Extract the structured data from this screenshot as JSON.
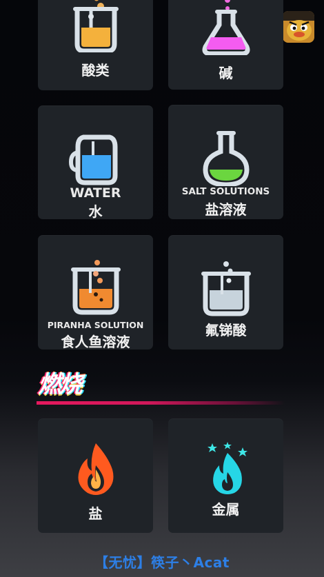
{
  "categories_top": [
    {
      "cn": "酸类",
      "en": ""
    },
    {
      "cn": "碱",
      "en": ""
    },
    {
      "cn": "水",
      "en": "WATER"
    },
    {
      "cn": "盐溶液",
      "en": "SALT SOLUTIONS"
    },
    {
      "cn": "食人鱼溶液",
      "en": "PIRANHA SOLUTION"
    },
    {
      "cn": "氟锑酸",
      "en": ""
    }
  ],
  "combustion_section": {
    "title": "燃烧",
    "items": [
      {
        "cn": "盐"
      },
      {
        "cn": "金属"
      }
    ]
  },
  "footer": {
    "credit": "【无忧】筷子丶Acat"
  },
  "icons": {
    "acids": "beaker-yellow-liquid-icon",
    "bases": "flask-pink-liquid-icon",
    "water": "water-jug-icon",
    "salt_solutions": "round-flask-green-icon",
    "piranha": "beaker-orange-bubbles-icon",
    "fluoroantimonic": "beaker-white-bubbles-icon",
    "salt_fire": "orange-flame-icon",
    "metal_fire": "cyan-flame-icon"
  },
  "colors": {
    "accent_rule": "#e6195e",
    "credit_blue": "#2d7fe6",
    "tile_bg": "#1f2328"
  }
}
